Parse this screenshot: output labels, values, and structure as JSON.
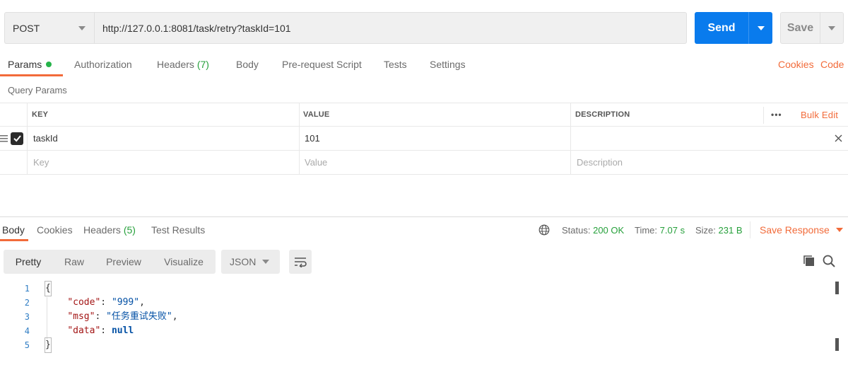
{
  "request": {
    "method": "POST",
    "url": "http://127.0.0.1:8081/task/retry?taskId=101",
    "send_label": "Send",
    "save_label": "Save"
  },
  "request_tabs": [
    {
      "label": "Params",
      "active": true,
      "has_dot": true
    },
    {
      "label": "Authorization"
    },
    {
      "label": "Headers",
      "count": "(7)"
    },
    {
      "label": "Body"
    },
    {
      "label": "Pre-request Script"
    },
    {
      "label": "Tests"
    },
    {
      "label": "Settings"
    }
  ],
  "right_links": {
    "cookies": "Cookies",
    "code": "Code"
  },
  "query_params": {
    "title": "Query Params",
    "columns": {
      "key": "KEY",
      "value": "VALUE",
      "description": "DESCRIPTION"
    },
    "bulk_edit": "Bulk Edit",
    "more": "•••",
    "rows": [
      {
        "key": "taskId",
        "value": "101",
        "description": "",
        "checked": true
      }
    ],
    "placeholders": {
      "key": "Key",
      "value": "Value",
      "description": "Description"
    }
  },
  "response_tabs": [
    {
      "label": "Body",
      "active": true
    },
    {
      "label": "Cookies"
    },
    {
      "label": "Headers",
      "count": "(5)"
    },
    {
      "label": "Test Results"
    }
  ],
  "response_meta": {
    "status_label": "Status:",
    "status": "200 OK",
    "time_label": "Time:",
    "time": "7.07 s",
    "size_label": "Size:",
    "size": "231 B",
    "save_response": "Save Response"
  },
  "format_tabs": [
    "Pretty",
    "Raw",
    "Preview",
    "Visualize"
  ],
  "format_select": "JSON",
  "code_lines": [
    {
      "n": "1",
      "text": "{"
    },
    {
      "n": "2",
      "key": "\"code\"",
      "val": "\"999\"",
      "tail": ","
    },
    {
      "n": "3",
      "key": "\"msg\"",
      "val": "\"任务重试失败\"",
      "tail": ","
    },
    {
      "n": "4",
      "key": "\"data\"",
      "val": "null",
      "tail": ""
    },
    {
      "n": "5",
      "text": "}"
    }
  ],
  "colors": {
    "accent": "#f26b3a",
    "send": "#097bed",
    "success": "#26a03b"
  }
}
